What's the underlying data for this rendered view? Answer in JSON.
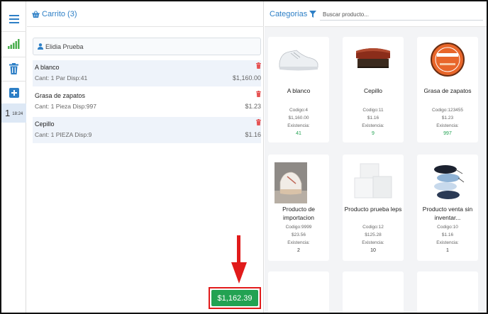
{
  "rail": {
    "ticket_number": "1",
    "ticket_time": "18:24"
  },
  "cart": {
    "title": "Carrito (3)",
    "client_name": "Elidia Prueba",
    "items": [
      {
        "name": "A blanco",
        "detail": "Cant: 1 Par Disp:41",
        "price": "$1,160.00"
      },
      {
        "name": "Grasa de zapatos",
        "detail": "Cant: 1 Pieza Disp:997",
        "price": "$1.23"
      },
      {
        "name": "Cepillo",
        "detail": "Cant: 1 PIEZA Disp:9",
        "price": "$1.16"
      }
    ],
    "total": "$1,162.39"
  },
  "catalog": {
    "title": "Categorias",
    "search_placeholder": "Buscar producto...",
    "products": [
      {
        "name": "A blanco",
        "code": "Codigo:4",
        "price": "$1,160.00",
        "stock_label": "Existencia:",
        "stock": "41",
        "stock_color": "#22a252",
        "icon": "white-sneaker-image"
      },
      {
        "name": "Cepillo",
        "code": "Codigo:11",
        "price": "$1.16",
        "stock_label": "Existencia:",
        "stock": "9",
        "stock_color": "#22a252",
        "icon": "shoe-brush-image"
      },
      {
        "name": "Grasa de zapatos",
        "code": "Codigo:123455",
        "price": "$1.23",
        "stock_label": "Existencia:",
        "stock": "997",
        "stock_color": "#22a252",
        "icon": "shoe-polish-tin-image"
      },
      {
        "name": "Producto de importacion",
        "code": "Codigo:9999",
        "price": "$23.56",
        "stock_label": "Existencia:",
        "stock": "2",
        "stock_color": "#333333",
        "icon": "platform-sneaker-image"
      },
      {
        "name": "Producto prueba leps",
        "code": "Codigo:12",
        "price": "$125.28",
        "stock_label": "Existencia:",
        "stock": "10",
        "stock_color": "#333333",
        "icon": "white-boxes-image"
      },
      {
        "name": "Producto venta sin inventar...",
        "code": "Codigo:10",
        "price": "$1.16",
        "stock_label": "Existencia:",
        "stock": "1",
        "stock_color": "#333333",
        "icon": "shoelaces-image"
      }
    ]
  },
  "colors": {
    "accent": "#2d7fc6",
    "total_button": "#22a252",
    "annotation": "#e11b1b",
    "trash": "#e55353",
    "selected_ticket": "#dde8f5"
  }
}
